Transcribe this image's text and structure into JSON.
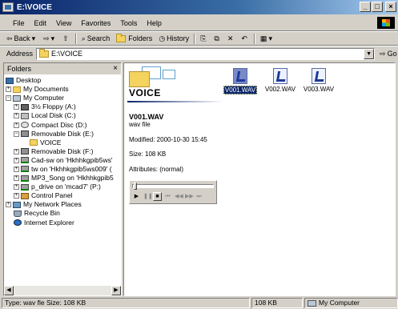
{
  "window": {
    "title": "E:\\VOICE"
  },
  "menu": [
    "File",
    "Edit",
    "View",
    "Favorites",
    "Tools",
    "Help"
  ],
  "toolbar": {
    "back": "Back",
    "search": "Search",
    "folders": "Folders",
    "history": "History"
  },
  "address": {
    "label": "Address",
    "value": "E:\\VOICE",
    "go": "Go"
  },
  "folders_pane": {
    "title": "Folders",
    "tree": [
      {
        "label": "Desktop"
      },
      {
        "label": "My Documents"
      },
      {
        "label": "My Computer"
      },
      {
        "label": "3½ Floppy (A:)"
      },
      {
        "label": "Local Disk (C:)"
      },
      {
        "label": "Compact Disc (D:)"
      },
      {
        "label": "Removable Disk (E:)"
      },
      {
        "label": "VOICE"
      },
      {
        "label": "Removable Disk (F:)"
      },
      {
        "label": "Cad-sw on 'Hkhhkgpib5ws'"
      },
      {
        "label": "tw on 'Hkhhkgpib5ws009' ("
      },
      {
        "label": "MP3_Song on 'Hkhhkgpib5"
      },
      {
        "label": "p_drive on 'mcad7' (P:)"
      },
      {
        "label": "Control Panel"
      },
      {
        "label": "My Network Places"
      },
      {
        "label": "Recycle Bin"
      },
      {
        "label": "Internet Explorer"
      }
    ]
  },
  "content": {
    "folder_title": "VOICE",
    "file_name": "V001.WAV",
    "file_type": "wav file",
    "modified": "Modified: 2000-10-30 15:45",
    "size": "Size: 108 KB",
    "attributes": "Attributes: (normal)",
    "files": [
      {
        "name": "V001.WAV"
      },
      {
        "name": "V002.WAV"
      },
      {
        "name": "V003.WAV"
      }
    ]
  },
  "statusbar": {
    "text": "Type: wav fle Size: 108 KB",
    "size": "108 KB",
    "zone": "My Computer"
  },
  "colors": {
    "titlebar": "#0a246a",
    "selection": "#0a246a",
    "chrome": "#d4d0c8"
  }
}
